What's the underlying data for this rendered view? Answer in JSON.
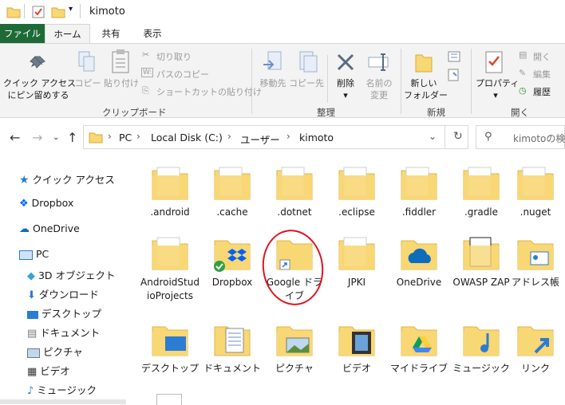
{
  "window": {
    "title": "kimoto"
  },
  "tabs": [
    {
      "label": "ファイル"
    },
    {
      "label": "ホーム"
    },
    {
      "label": "共有"
    },
    {
      "label": "表示"
    }
  ],
  "ribbon": {
    "pin": "クイック アクセス\nにピン留めする",
    "copy": "コピー",
    "paste": "貼り付け",
    "cut": "切り取り",
    "copy_path": "パスのコピー",
    "paste_shortcut": "ショートカットの貼り付け",
    "group_clipboard": "クリップボード",
    "move_to": "移動先",
    "copy_to": "コピー先",
    "delete": "削除",
    "rename": "名前の\n変更",
    "group_organize": "整理",
    "new_folder": "新しい\nフォルダー",
    "group_new": "新規",
    "properties": "プロパティ",
    "open": "開く",
    "edit": "編集",
    "history": "履歴",
    "group_open": "開く"
  },
  "breadcrumb": [
    "PC",
    "Local Disk (C:)",
    "ユーザー",
    "kimoto"
  ],
  "search": {
    "placeholder": "kimotoの検"
  },
  "sidebar": {
    "items": [
      {
        "label": "クイック アクセス",
        "icon": "star-icon"
      },
      {
        "label": "Dropbox",
        "icon": "dropbox-icon"
      },
      {
        "label": "OneDrive",
        "icon": "cloud-icon"
      },
      {
        "label": "PC",
        "icon": "pc-icon"
      },
      {
        "label": "3D オブジェクト",
        "icon": "cube-icon"
      },
      {
        "label": "ダウンロード",
        "icon": "download-icon"
      },
      {
        "label": "デスクトップ",
        "icon": "desktop-icon"
      },
      {
        "label": "ドキュメント",
        "icon": "document-icon"
      },
      {
        "label": "ピクチャ",
        "icon": "picture-icon"
      },
      {
        "label": "ビデオ",
        "icon": "video-icon"
      },
      {
        "label": "ミュージック",
        "icon": "music-icon"
      }
    ]
  },
  "files": [
    {
      "label": ".android"
    },
    {
      "label": ".cache"
    },
    {
      "label": ".dotnet"
    },
    {
      "label": ".eclipse"
    },
    {
      "label": ".fiddler"
    },
    {
      "label": ".gradle"
    },
    {
      "label": ".nuget"
    },
    {
      "label": "AndroidStudioProjects"
    },
    {
      "label": "Dropbox"
    },
    {
      "label": "Google ドライブ"
    },
    {
      "label": "JPKI"
    },
    {
      "label": "OneDrive"
    },
    {
      "label": "OWASP ZAP"
    },
    {
      "label": "アドレス帳"
    },
    {
      "label": "デスクトップ"
    },
    {
      "label": "ドキュメント"
    },
    {
      "label": "ピクチャ"
    },
    {
      "label": "ビデオ"
    },
    {
      "label": "マイドライブ"
    },
    {
      "label": "ミュージック"
    },
    {
      "label": "リンク"
    }
  ],
  "colors": {
    "folder": "#f8d775",
    "file_tab": "#1d6a37",
    "annotation": "#e0141e",
    "accent": "#2b7cd3"
  }
}
